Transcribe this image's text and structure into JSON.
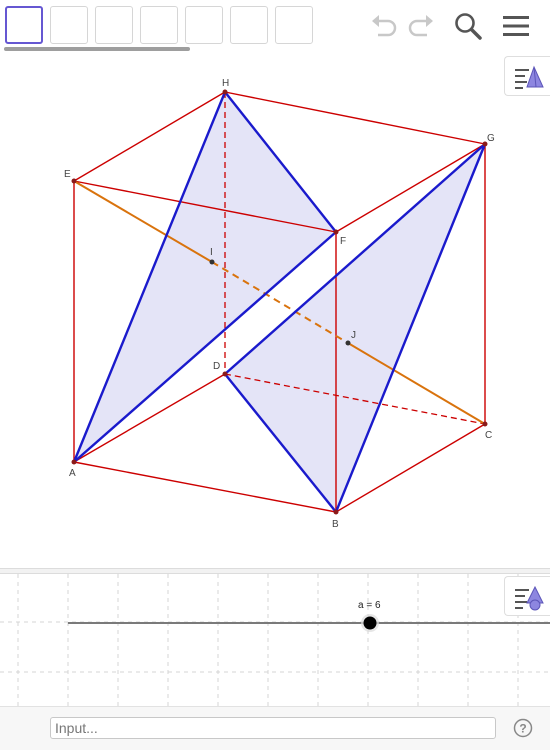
{
  "toolbar": {
    "tools": [
      {
        "name": "tool-slot-1",
        "selected": true
      },
      {
        "name": "tool-slot-2",
        "selected": false
      },
      {
        "name": "tool-slot-3",
        "selected": false
      },
      {
        "name": "tool-slot-4",
        "selected": false
      },
      {
        "name": "tool-slot-5",
        "selected": false
      },
      {
        "name": "tool-slot-6",
        "selected": false
      },
      {
        "name": "tool-slot-7",
        "selected": false
      }
    ],
    "icons": [
      "undo-icon",
      "redo-icon",
      "search-icon",
      "menu-icon"
    ]
  },
  "points": {
    "A": "A",
    "B": "B",
    "C": "C",
    "D": "D",
    "E": "E",
    "F": "F",
    "G": "G",
    "H": "H",
    "I": "I",
    "J": "J"
  },
  "slider": {
    "label": "a = 6",
    "name": "a",
    "value": 6
  },
  "input": {
    "placeholder": "Input..."
  },
  "help": {
    "label": "?"
  },
  "colors": {
    "accent": "#6557d2",
    "cube_edge": "#cc0000",
    "tetra_edge": "#1a1acc",
    "segment": "#d9730d",
    "face_fill": "#dcdcf5"
  }
}
